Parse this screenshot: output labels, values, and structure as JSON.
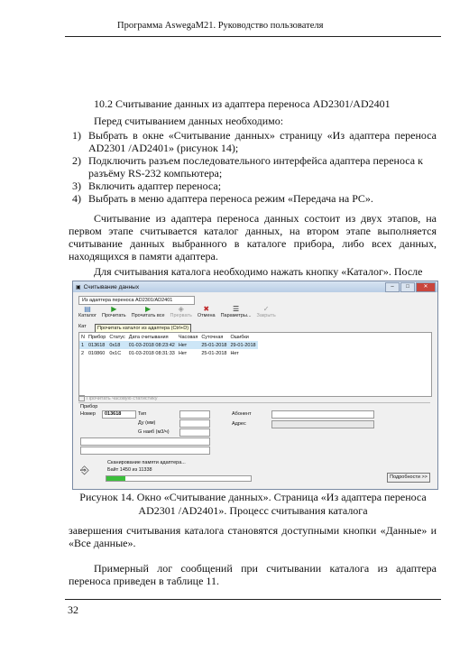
{
  "header": {
    "title": "Программа AswegaM21. Руководство пользователя"
  },
  "section_title": "10.2 Считывание данных из адаптера переноса AD2301/AD2401",
  "intro": "Перед считыванием данных необходимо:",
  "steps": [
    {
      "num": "1)",
      "text": "Выбрать в окне «Считывание данных» страницу «Из адаптера переноса AD2301 /AD2401» (рисунок 14);"
    },
    {
      "num": "2)",
      "text": "Подключить разъем последовательного интерфейса адаптера переноса к разъёму RS-232 компьютера;"
    },
    {
      "num": "3)",
      "text": "Включить адаптер переноса;"
    },
    {
      "num": "4)",
      "text": "Выбрать в меню адаптера переноса режим «Передача на PC»."
    }
  ],
  "paragraph1": "Считывание из адаптера переноса данных состоит из двух этапов, на первом этапе считывается каталог данных, на втором этапе выполняется считывание данных выбранного в каталоге прибора, либо всех данных, находящихся в памяти адаптера.",
  "paragraph2": "Для считывания каталога необходимо нажать кнопку «Каталог». После",
  "window": {
    "title": "Считывание данных",
    "tab": "Из адаптера переноса AD2301/AD2401",
    "toolbar": [
      {
        "label": "Каталог",
        "icon": "catalog-icon"
      },
      {
        "label": "Прочитать",
        "icon": "play-icon"
      },
      {
        "label": "Прочитать все",
        "icon": "play-all-icon"
      },
      {
        "label": "Прервать",
        "icon": "stop-icon"
      },
      {
        "label": "Отмена",
        "icon": "cancel-icon"
      },
      {
        "label": "Параметры...",
        "icon": "settings-icon"
      },
      {
        "label": "Закрыть",
        "icon": "close-icon"
      }
    ],
    "tooltip": "Прочитать каталог из адаптера (Ctrl+D)",
    "subtab": "Кат",
    "table": {
      "headers": [
        "N",
        "Прибор",
        "Статус",
        "Дата считывания",
        "Часовая",
        "Суточная",
        "Ошибки"
      ],
      "rows": [
        [
          "1",
          "013618",
          "0x18",
          "01-03-2018 08:23:42",
          "Нет",
          "25-01-2018",
          "29-01-2018"
        ],
        [
          "2",
          "010860",
          "0x1C",
          "01-03-2018 08:31:33",
          "Нет",
          "25-01-2018",
          "Нет"
        ]
      ]
    },
    "checkbox": "Прочитать часовую статистику",
    "device_group": {
      "title": "Прибор",
      "number_label": "Номер",
      "number_value": "013618",
      "type_label": "Тип",
      "du_label": "Ду (мм)",
      "g_label": "G наиб (м3/ч)",
      "subscriber_label": "Абонент",
      "address_label": "Адрес"
    },
    "status_line1": "Сканирование памяти адаптера...",
    "status_line2": "Байт 1450 из 11338",
    "progress": 0.13,
    "details_button": "Подробности >>"
  },
  "caption_line1": "Рисунок 14. Окно «Считывание данных». Страница «Из адаптера переноса",
  "caption_line2": "AD2301 /AD2401». Процесс считывания каталога",
  "paragraph3": "завершения считывания каталога становятся доступными кнопки «Данные» и «Все данные».",
  "paragraph4": "Примерный лог сообщений при считывании каталога из адаптера переноса приведен в таблице 11.",
  "page_number": "32"
}
